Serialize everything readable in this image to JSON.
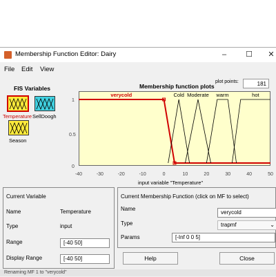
{
  "window": {
    "title": "Membership Function Editor: Dairy"
  },
  "controls": {
    "minimize": "–",
    "maximize": "☐",
    "close": "✕"
  },
  "menu": [
    "File",
    "Edit",
    "View"
  ],
  "fis": {
    "title": "FIS Variables",
    "inputs": [
      {
        "name": "Temperature",
        "selected": true
      },
      {
        "name": "SellDoogh",
        "selected": false
      }
    ],
    "outputs": [
      {
        "name": "Season"
      }
    ]
  },
  "plot": {
    "title": "Membership function plots",
    "points_label": "plot points:",
    "points_value": "181",
    "xlabel": "input variable \"Temperature\"",
    "xticks": [
      "-40",
      "-30",
      "-20",
      "-10",
      "0",
      "10",
      "20",
      "30",
      "40",
      "50"
    ],
    "yticks": [
      "1",
      "0.5",
      "0"
    ]
  },
  "chart_data": {
    "type": "line",
    "xlim": [
      -40,
      50
    ],
    "ylim": [
      0,
      1
    ],
    "xlabel": "input variable \"Temperature\"",
    "series": [
      {
        "name": "verycold",
        "selected": true,
        "points": [
          [
            -40,
            1
          ],
          [
            0,
            1
          ],
          [
            5,
            0
          ],
          [
            50,
            0
          ]
        ]
      },
      {
        "name": "Cold",
        "points": [
          [
            2,
            0
          ],
          [
            7,
            1
          ],
          [
            12,
            0
          ]
        ]
      },
      {
        "name": "Moderate",
        "points": [
          [
            10,
            0
          ],
          [
            16,
            1
          ],
          [
            22,
            0
          ]
        ]
      },
      {
        "name": "warm",
        "points": [
          [
            20,
            0
          ],
          [
            25,
            1
          ],
          [
            30,
            1
          ],
          [
            34,
            0
          ]
        ]
      },
      {
        "name": "hot",
        "points": [
          [
            32,
            0
          ],
          [
            36,
            1
          ],
          [
            50,
            1
          ]
        ]
      }
    ]
  },
  "current_variable": {
    "header": "Current Variable",
    "name_label": "Name",
    "name_value": "Temperature",
    "type_label": "Type",
    "type_value": "input",
    "range_label": "Range",
    "range_value": "[-40 50]",
    "display_range_label": "Display Range",
    "display_range_value": "[-40 50]"
  },
  "current_mf": {
    "header": "Current Membership Function (click on MF to select)",
    "name_label": "Name",
    "name_value": "verycold",
    "type_label": "Type",
    "type_value": "trapmf",
    "params_label": "Params",
    "params_value": "[-Inf 0 0 5]"
  },
  "buttons": {
    "help": "Help",
    "close": "Close"
  },
  "status": {
    "text": "Renaming MF 1 to \"verycold\""
  },
  "colors": {
    "plot_bg": "#ffffcc",
    "selected": "#d00000",
    "normal": "#000000",
    "accent": "#00c0c0"
  }
}
